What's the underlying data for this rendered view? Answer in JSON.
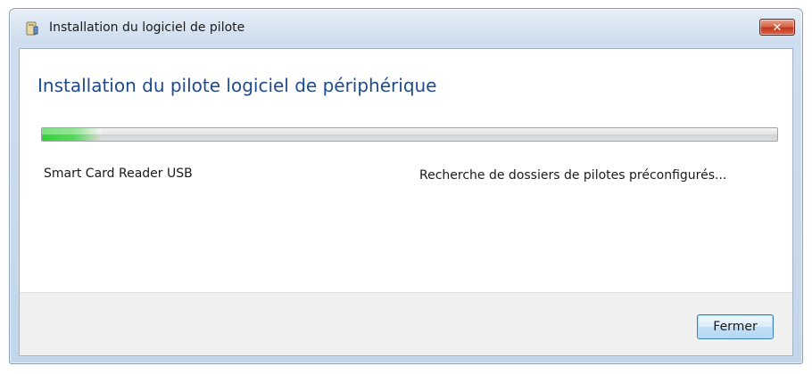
{
  "window": {
    "title": "Installation du logiciel de pilote",
    "close_glyph": "✕"
  },
  "main": {
    "heading": "Installation du pilote logiciel de périphérique",
    "progress_fraction": 0.08,
    "device_name": "Smart Card Reader USB",
    "status": "Recherche de dossiers de pilotes préconfigurés..."
  },
  "footer": {
    "close_label": "Fermer"
  },
  "icons": {
    "title_icon": "driver-install-icon",
    "close_icon": "close-icon"
  },
  "colors": {
    "heading": "#1e4b8e",
    "progress_green": "#35d13a",
    "close_red": "#c1381d"
  }
}
